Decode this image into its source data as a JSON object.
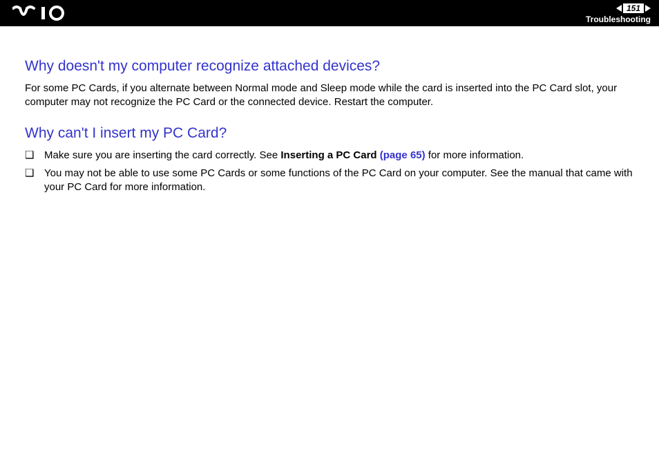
{
  "header": {
    "page_number": "151",
    "section": "Troubleshooting"
  },
  "content": {
    "q1": {
      "heading": "Why doesn't my computer recognize attached devices?",
      "body": "For some PC Cards, if you alternate between Normal mode and Sleep mode while the card is inserted into the PC Card slot, your computer may not recognize the PC Card or the connected device. Restart the computer."
    },
    "q2": {
      "heading": "Why can't I insert my PC Card?",
      "bullets": [
        {
          "pre": "Make sure you are inserting the card correctly. See ",
          "bold": "Inserting a PC Card ",
          "link": "(page 65)",
          "post": " for more information."
        },
        {
          "pre": "You may not be able to use some PC Cards or some functions of the PC Card on your computer. See the manual that came with your PC Card for more information.",
          "bold": "",
          "link": "",
          "post": ""
        }
      ]
    }
  }
}
